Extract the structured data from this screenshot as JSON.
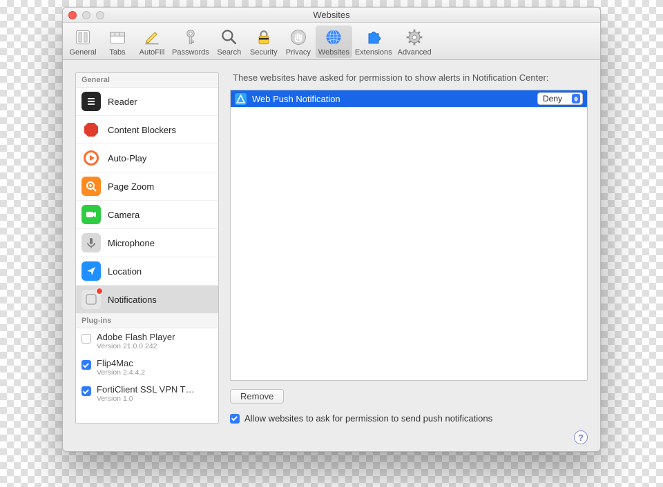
{
  "window": {
    "title": "Websites"
  },
  "toolbar": {
    "items": [
      {
        "id": "general",
        "label": "General"
      },
      {
        "id": "tabs",
        "label": "Tabs"
      },
      {
        "id": "autofill",
        "label": "AutoFill"
      },
      {
        "id": "passwords",
        "label": "Passwords"
      },
      {
        "id": "search",
        "label": "Search"
      },
      {
        "id": "security",
        "label": "Security"
      },
      {
        "id": "privacy",
        "label": "Privacy"
      },
      {
        "id": "websites",
        "label": "Websites",
        "selected": true
      },
      {
        "id": "extensions",
        "label": "Extensions"
      },
      {
        "id": "advanced",
        "label": "Advanced"
      }
    ]
  },
  "sidebar": {
    "section_general": "General",
    "items": [
      {
        "id": "reader",
        "label": "Reader"
      },
      {
        "id": "content-blockers",
        "label": "Content Blockers"
      },
      {
        "id": "auto-play",
        "label": "Auto-Play"
      },
      {
        "id": "page-zoom",
        "label": "Page Zoom"
      },
      {
        "id": "camera",
        "label": "Camera"
      },
      {
        "id": "microphone",
        "label": "Microphone"
      },
      {
        "id": "location",
        "label": "Location"
      },
      {
        "id": "notifications",
        "label": "Notifications",
        "selected": true
      }
    ],
    "section_plugins": "Plug-ins",
    "plugins": [
      {
        "name": "Adobe Flash Player",
        "version": "Version 21.0.0.242",
        "enabled": false
      },
      {
        "name": "Flip4Mac",
        "version": "Version 2.4.4.2",
        "enabled": true
      },
      {
        "name": "FortiClient SSL VPN T…",
        "version": "Version 1.0",
        "enabled": true
      }
    ]
  },
  "main": {
    "desc": "These websites have asked for permission to show alerts in Notification Center:",
    "rows": [
      {
        "site": "Web Push Notification",
        "value": "Deny",
        "selected": true
      }
    ],
    "remove": "Remove",
    "allow_label": "Allow websites to ask for permission to send push notifications",
    "allow_checked": true
  }
}
